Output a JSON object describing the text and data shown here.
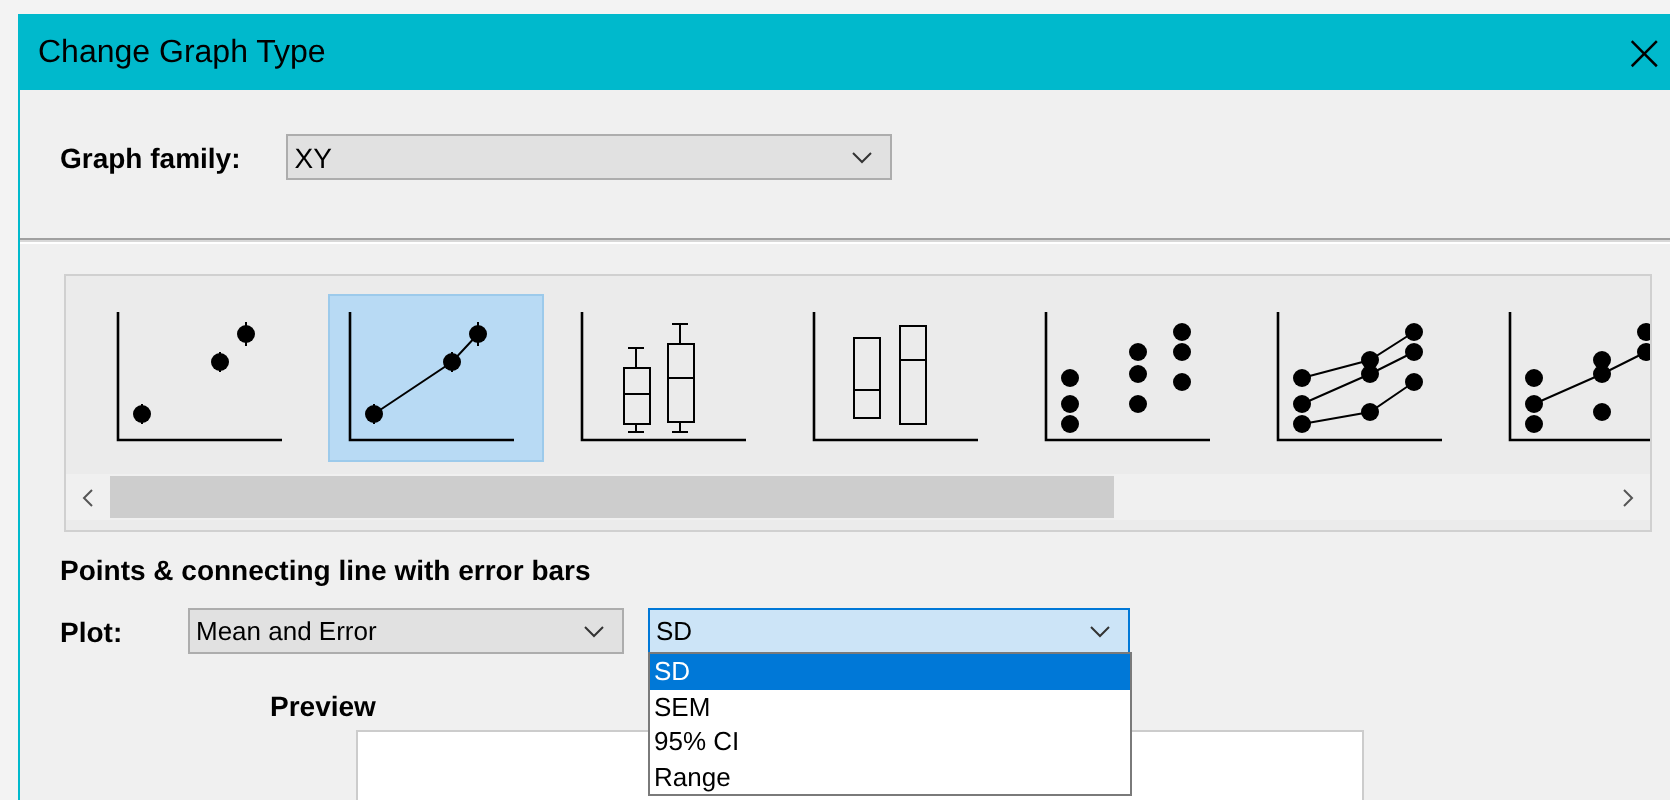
{
  "window": {
    "title": "Change Graph Type",
    "close": "×"
  },
  "graph_family": {
    "label": "Graph family:",
    "value": "XY"
  },
  "gallery": [
    {
      "kind": "scatter-error",
      "selected": false
    },
    {
      "kind": "line-error",
      "selected": true
    },
    {
      "kind": "box",
      "selected": false
    },
    {
      "kind": "floating-bar",
      "selected": false
    },
    {
      "kind": "column-dots",
      "selected": false
    },
    {
      "kind": "multi-line",
      "selected": false
    },
    {
      "kind": "multi-line-partial",
      "selected": false
    }
  ],
  "caption": "Points & connecting line with error bars",
  "plot": {
    "label": "Plot:",
    "type": "Mean and Error",
    "error": "SD",
    "options": [
      {
        "label": "SD",
        "selected": true
      },
      {
        "label": "SEM",
        "selected": false
      },
      {
        "label": "95% CI",
        "selected": false
      },
      {
        "label": "Range",
        "selected": false
      }
    ]
  },
  "preview": {
    "label": "Preview"
  }
}
